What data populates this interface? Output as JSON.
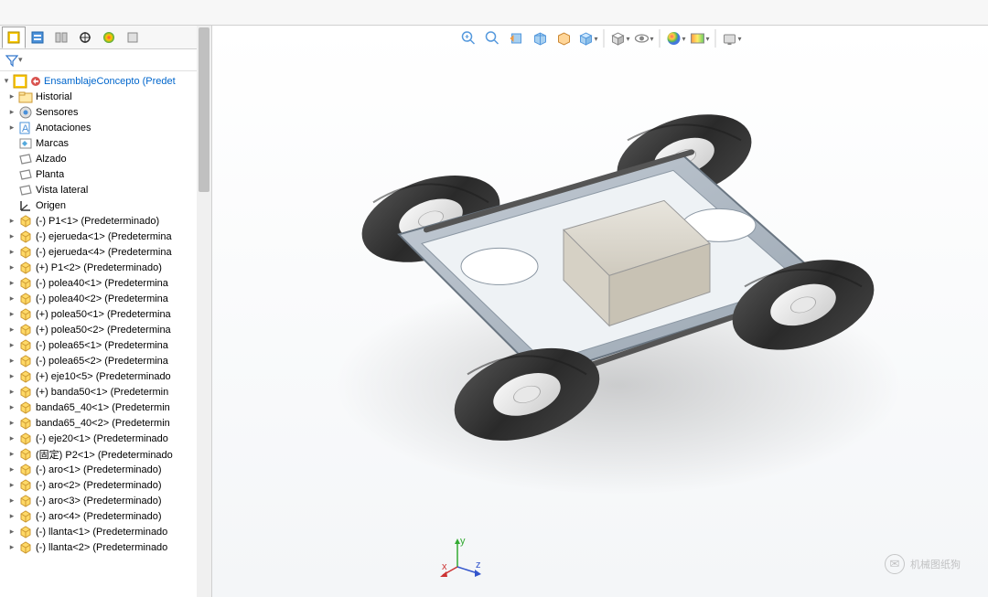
{
  "rootNode": {
    "label": "EnsamblajeConcepto  (Predet",
    "class": "blue"
  },
  "treeItems": [
    {
      "icon": "folder",
      "label": "Historial",
      "exp": "▸"
    },
    {
      "icon": "sensor",
      "label": "Sensores",
      "exp": "▸"
    },
    {
      "icon": "anno",
      "label": "Anotaciones",
      "exp": "▸"
    },
    {
      "icon": "brand",
      "label": "Marcas",
      "exp": ""
    },
    {
      "icon": "plane",
      "label": "Alzado",
      "exp": ""
    },
    {
      "icon": "plane",
      "label": "Planta",
      "exp": ""
    },
    {
      "icon": "plane",
      "label": "Vista lateral",
      "exp": ""
    },
    {
      "icon": "origin",
      "label": "Origen",
      "exp": ""
    },
    {
      "icon": "part",
      "label": "(-) P1<1> (Predeterminado)",
      "exp": "▸"
    },
    {
      "icon": "part",
      "label": "(-) ejerueda<1> (Predetermina",
      "exp": "▸"
    },
    {
      "icon": "part",
      "label": "(-) ejerueda<4> (Predetermina",
      "exp": "▸"
    },
    {
      "icon": "part",
      "label": "(+) P1<2> (Predeterminado)",
      "exp": "▸"
    },
    {
      "icon": "part",
      "label": "(-) polea40<1> (Predetermina",
      "exp": "▸"
    },
    {
      "icon": "part",
      "label": "(-) polea40<2> (Predetermina",
      "exp": "▸"
    },
    {
      "icon": "part",
      "label": "(+) polea50<1> (Predetermina",
      "exp": "▸"
    },
    {
      "icon": "part",
      "label": "(+) polea50<2> (Predetermina",
      "exp": "▸"
    },
    {
      "icon": "part",
      "label": "(-) polea65<1> (Predetermina",
      "exp": "▸"
    },
    {
      "icon": "part",
      "label": "(-) polea65<2> (Predetermina",
      "exp": "▸"
    },
    {
      "icon": "part",
      "label": "(+) eje10<5> (Predeterminado",
      "exp": "▸"
    },
    {
      "icon": "part",
      "label": "(+) banda50<1> (Predetermin",
      "exp": "▸"
    },
    {
      "icon": "part",
      "label": "banda65_40<1> (Predetermin",
      "exp": "▸"
    },
    {
      "icon": "part",
      "label": "banda65_40<2> (Predetermin",
      "exp": "▸"
    },
    {
      "icon": "part",
      "label": "(-) eje20<1> (Predeterminado",
      "exp": "▸"
    },
    {
      "icon": "part",
      "label": "(固定) P2<1> (Predeterminado",
      "exp": "▸"
    },
    {
      "icon": "part",
      "label": "(-) aro<1> (Predeterminado)",
      "exp": "▸"
    },
    {
      "icon": "part",
      "label": "(-) aro<2> (Predeterminado)",
      "exp": "▸"
    },
    {
      "icon": "part",
      "label": "(-) aro<3> (Predeterminado)",
      "exp": "▸"
    },
    {
      "icon": "part",
      "label": "(-) aro<4> (Predeterminado)",
      "exp": "▸"
    },
    {
      "icon": "part",
      "label": "(-) llanta<1> (Predeterminado",
      "exp": "▸"
    },
    {
      "icon": "part",
      "label": "(-) llanta<2> (Predeterminado",
      "exp": "▸"
    }
  ],
  "watermark": "机械图纸狗",
  "triad": {
    "x": "x",
    "y": "y",
    "z": "z"
  }
}
